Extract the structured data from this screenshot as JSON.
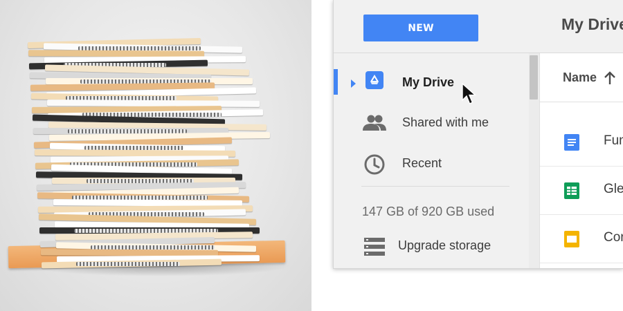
{
  "header": {
    "new_button_label": "NEW",
    "page_title": "My Drive"
  },
  "sidebar": {
    "items": [
      {
        "label": "My Drive",
        "icon": "drive-icon",
        "active": true
      },
      {
        "label": "Shared with me",
        "icon": "people-icon"
      },
      {
        "label": "Recent",
        "icon": "clock-icon"
      }
    ],
    "storage_text": "147 GB of 920 GB used",
    "upgrade_label": "Upgrade storage"
  },
  "file_list": {
    "column_header": "Name",
    "sort_icon": "arrow-up-icon",
    "rows": [
      {
        "name": "Fun",
        "type": "docs",
        "icon": "docs-icon",
        "color": "#4285f4"
      },
      {
        "name": "Gle",
        "type": "sheets",
        "icon": "sheets-icon",
        "color": "#0f9d58"
      },
      {
        "name": "Cor",
        "type": "slides",
        "icon": "slides-icon",
        "color": "#f4b400"
      }
    ]
  },
  "colors": {
    "accent": "#4285f4",
    "sidebar_background": "#f1f1f1"
  }
}
